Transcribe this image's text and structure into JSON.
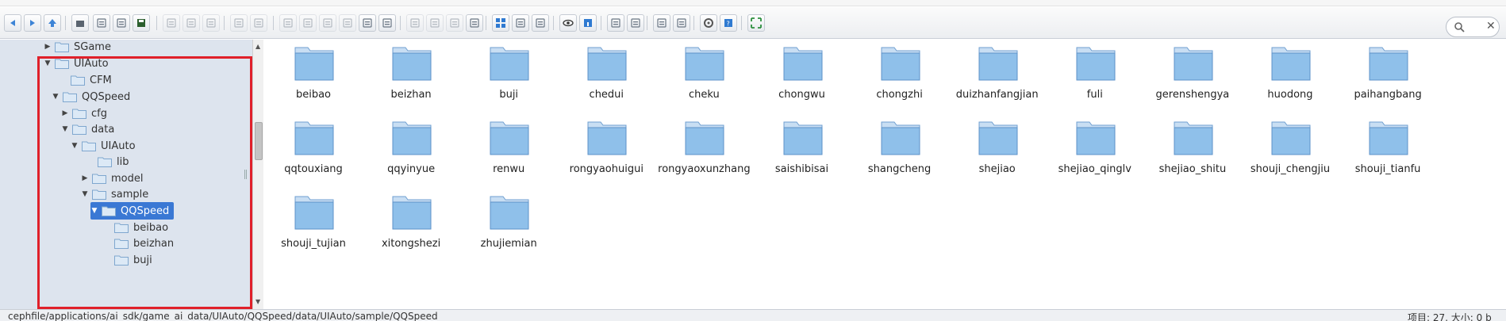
{
  "colors": {
    "accent": "#3a78d4",
    "highlight_box": "#e0202a",
    "tree_bg": "#dde4ee",
    "folder": "#8fc0ea"
  },
  "toolbar": {
    "buttons": [
      {
        "icon": "back-icon"
      },
      {
        "icon": "forward-icon"
      },
      {
        "icon": "up-icon"
      },
      {
        "icon": "home-icon"
      },
      {
        "icon": "download-icon"
      },
      {
        "icon": "upload-icon"
      },
      {
        "icon": "save-icon"
      },
      {
        "icon": "new-folder-icon"
      },
      {
        "icon": "new-file-icon"
      },
      {
        "icon": "select-icon"
      },
      {
        "icon": "undo-icon"
      },
      {
        "icon": "redo-icon"
      },
      {
        "icon": "copy-icon"
      },
      {
        "icon": "cut-icon"
      },
      {
        "icon": "paste-icon"
      },
      {
        "icon": "duplicate-icon"
      },
      {
        "icon": "delete-icon"
      },
      {
        "icon": "link-icon"
      },
      {
        "icon": "edit-icon"
      },
      {
        "icon": "compress-icon"
      },
      {
        "icon": "extract-icon"
      },
      {
        "icon": "permissions-icon"
      },
      {
        "icon": "icons-view-icon"
      },
      {
        "icon": "small-icons-view-icon"
      },
      {
        "icon": "columns-view-icon"
      },
      {
        "icon": "preview-icon"
      },
      {
        "icon": "info-icon"
      },
      {
        "icon": "sort-icon"
      },
      {
        "icon": "resize-icon"
      },
      {
        "icon": "list-view-icon"
      },
      {
        "icon": "details-icon"
      },
      {
        "icon": "settings-icon"
      },
      {
        "icon": "help-icon"
      },
      {
        "icon": "fullscreen-icon"
      }
    ],
    "search_placeholder": ""
  },
  "tree": {
    "nodes": [
      {
        "label": "SGame",
        "expanded": false,
        "has_children": true
      },
      {
        "label": "UIAuto",
        "expanded": true,
        "has_children": true
      },
      {
        "label": "CFM",
        "expanded": false,
        "has_children": false
      },
      {
        "label": "QQSpeed",
        "expanded": true,
        "has_children": true
      },
      {
        "label": "cfg",
        "expanded": false,
        "has_children": true
      },
      {
        "label": "data",
        "expanded": true,
        "has_children": true
      },
      {
        "label": "UIAuto",
        "expanded": true,
        "has_children": true
      },
      {
        "label": "lib",
        "expanded": false,
        "has_children": false
      },
      {
        "label": "model",
        "expanded": false,
        "has_children": true
      },
      {
        "label": "sample",
        "expanded": true,
        "has_children": true
      },
      {
        "label": "QQSpeed",
        "expanded": true,
        "has_children": true,
        "selected": true
      },
      {
        "label": "beibao",
        "expanded": false,
        "has_children": false
      },
      {
        "label": "beizhan",
        "expanded": false,
        "has_children": false
      },
      {
        "label": "buji",
        "expanded": false,
        "has_children": false
      }
    ]
  },
  "files": [
    "beibao",
    "beizhan",
    "buji",
    "chedui",
    "cheku",
    "chongwu",
    "chongzhi",
    "duizhanfangjian",
    "fuli",
    "gerenshengya",
    "huodong",
    "paihangbang",
    "qqtouxiang",
    "qqyinyue",
    "renwu",
    "rongyaohuigui",
    "rongyaoxunzhang",
    "saishibisai",
    "shangcheng",
    "shejiao",
    "shejiao_qinglv",
    "shejiao_shitu",
    "shouji_chengjiu",
    "shouji_tianfu",
    "shouji_tujian",
    "xitongshezi",
    "zhujiemian"
  ],
  "status": {
    "path": "cephfile/applications/ai_sdk/game_ai_data/UIAuto/QQSpeed/data/UIAuto/sample/QQSpeed",
    "info": "项目: 27, 大小: 0 b"
  }
}
